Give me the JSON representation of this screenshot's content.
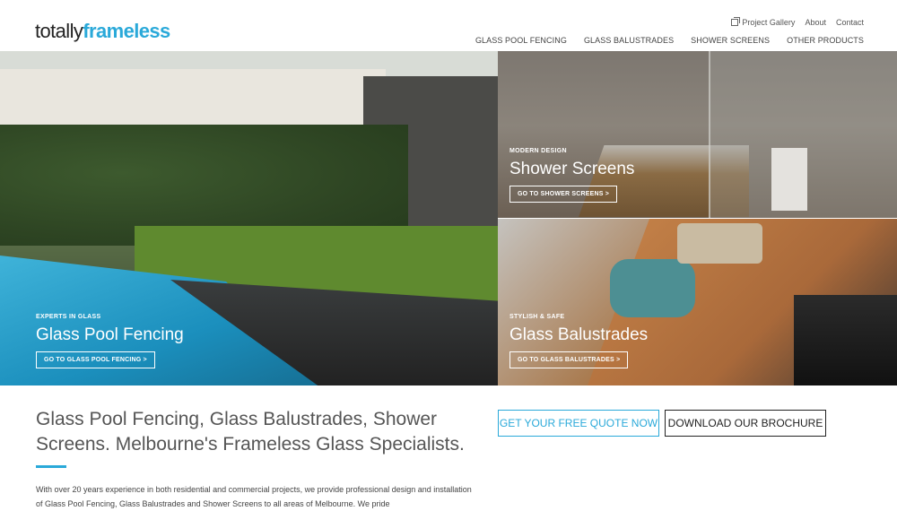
{
  "brand": {
    "name_prefix": "totally",
    "name_suffix": "frameless"
  },
  "utility_nav": {
    "project_gallery": "Project Gallery",
    "about": "About",
    "contact": "Contact"
  },
  "main_nav": [
    "GLASS POOL FENCING",
    "GLASS BALUSTRADES",
    "SHOWER SCREENS",
    "OTHER PRODUCTS"
  ],
  "tiles": {
    "pool": {
      "eyebrow": "EXPERTS IN GLASS",
      "title": "Glass Pool Fencing",
      "button": "GO TO GLASS POOL FENCING  >"
    },
    "shower": {
      "eyebrow": "MODERN DESIGN",
      "title": "Shower Screens",
      "button": "GO TO SHOWER SCREENS  >"
    },
    "balustrade": {
      "eyebrow": "STYLISH & SAFE",
      "title": "Glass Balustrades",
      "button": "GO TO GLASS BALUSTRADES  >"
    }
  },
  "intro": {
    "headline": "Glass Pool Fencing, Glass Balustrades, Shower Screens. Melbourne's Frameless Glass Specialists.",
    "body": "With over 20 years experience in both residential and commercial projects, we provide professional design and installation of Glass Pool Fencing, Glass Balustrades and Shower Screens to all areas of Melbourne. We pride",
    "quote_button": "GET YOUR FREE QUOTE NOW",
    "brochure_button": "DOWNLOAD OUR BROCHURE"
  },
  "colors": {
    "accent": "#2aa9d9",
    "text": "#333333"
  }
}
